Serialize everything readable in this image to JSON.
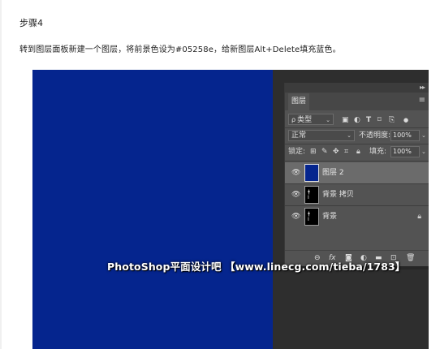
{
  "article": {
    "step_title": "步骤4",
    "instruction": "转到图层面板新建一个图层，将前景色设为#05258e，给新图层Alt+Delete填充蓝色。"
  },
  "colors": {
    "foreground": "#05258e",
    "workspace": "#2e2e2e",
    "panel": "#535353"
  },
  "layers_panel": {
    "collapse_icon": "double-chevron-right-icon",
    "tab_label": "图层",
    "menu_icon": "panel-menu-icon",
    "filter_lead": "ρ",
    "filter_value": "类型",
    "filter_icons": [
      "image-filter-icon",
      "adjustment-filter-icon",
      "type-filter-icon",
      "shape-filter-icon",
      "smartobject-filter-icon",
      "filter-toggle-icon"
    ],
    "blend_mode": "正常",
    "opacity_label": "不透明度:",
    "opacity_value": "100%",
    "lock_label": "锁定:",
    "lock_icons": [
      "lock-transparent-icon",
      "lock-paint-icon",
      "lock-move-icon",
      "lock-artboard-icon",
      "lock-all-icon"
    ],
    "fill_label": "填充:",
    "fill_value": "100%",
    "layers": [
      {
        "name": "图层 2",
        "selected": true,
        "visible": true,
        "thumb": "blue"
      },
      {
        "name": "背景 拷贝",
        "selected": false,
        "visible": true,
        "thumb": "black"
      },
      {
        "name": "背景",
        "selected": false,
        "visible": true,
        "thumb": "black",
        "locked": true
      }
    ],
    "bottom_icons": [
      "link-icon",
      "fx-icon",
      "mask-icon",
      "adjustment-icon",
      "group-folder-icon",
      "new-layer-icon",
      "trash-icon"
    ]
  },
  "watermark": "PhotoShop平面设计吧 【www.linecg.com/tieba/1783】"
}
